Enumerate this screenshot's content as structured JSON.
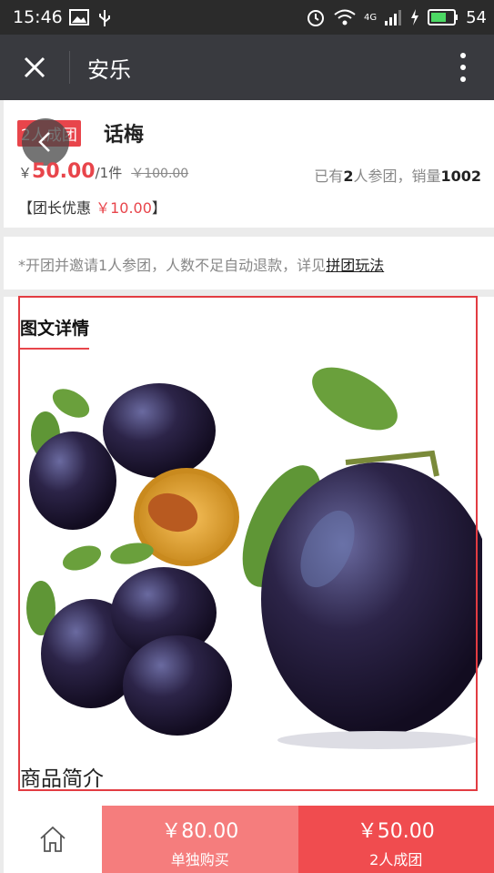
{
  "statusbar": {
    "time": "15:46",
    "battery": "54",
    "network": "4G"
  },
  "titlebar": {
    "title": "安乐"
  },
  "product": {
    "tag": "2人成团",
    "name": "话梅",
    "yen": "￥",
    "price": "50.00",
    "unit": "/1件",
    "old_price": "￥100.00",
    "joined_prefix": "已有",
    "joined_count": "2",
    "joined_suffix": "人参团，销量",
    "sales": "1002",
    "leader_label_open": "【团长优惠 ",
    "leader_discount": "￥10.00",
    "leader_label_close": "】"
  },
  "rule": {
    "text": "*开团并邀请1人参团，人数不足自动退款，详见",
    "link": "拼团玩法"
  },
  "detail": {
    "title": "图文详情",
    "intro": "商品简介"
  },
  "bottom": {
    "solo_price": "￥80.00",
    "solo_label": "单独购买",
    "group_price": "￥50.00",
    "group_label": "2人成团"
  },
  "colors": {
    "accent": "#e8454b",
    "titlebar": "#393a3f",
    "solo_btn": "#f57d7d",
    "group_btn": "#f04c4f"
  }
}
